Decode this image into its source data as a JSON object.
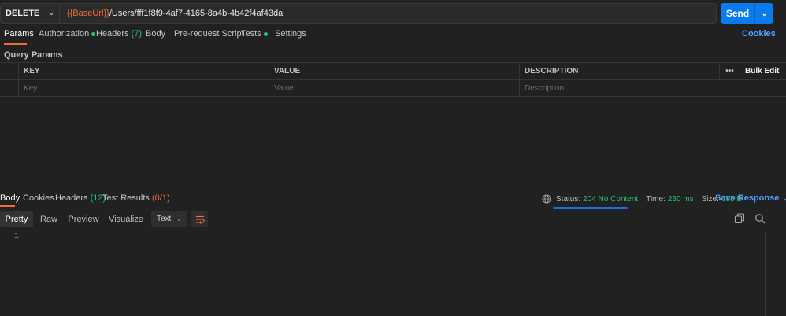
{
  "request": {
    "method": "DELETE",
    "url_variable": "{{BaseUrl}}",
    "url_path": "/Users/fff1f8f9-4af7-4165-8a4b-4b42f4af43da",
    "send_label": "Send"
  },
  "request_tabs": {
    "params": "Params",
    "authorization": "Authorization",
    "headers": "Headers",
    "headers_count": "(7)",
    "body": "Body",
    "prerequest": "Pre-request Script",
    "tests": "Tests",
    "settings": "Settings",
    "cookies": "Cookies"
  },
  "query_params": {
    "label": "Query Params",
    "columns": {
      "key": "KEY",
      "value": "VALUE",
      "description": "DESCRIPTION"
    },
    "bulk_edit": "Bulk Edit",
    "more": "•••",
    "placeholders": {
      "key": "Key",
      "value": "Value",
      "description": "Description"
    }
  },
  "response_tabs": {
    "body": "Body",
    "cookies": "Cookies",
    "headers": "Headers",
    "headers_count": "(12)",
    "test_results": "Test Results",
    "test_results_count": "(0/1)"
  },
  "response_status": {
    "status_label": "Status:",
    "status_value": "204 No Content",
    "time_label": "Time:",
    "time_value": "230 ms",
    "size_label": "Size:",
    "size_value": "688 B",
    "save_response": "Save Response"
  },
  "view": {
    "pretty": "Pretty",
    "raw": "Raw",
    "preview": "Preview",
    "visualize": "Visualize",
    "format": "Text",
    "line_number": "1"
  },
  "colors": {
    "accent": "#f26b3a",
    "send": "#097bed",
    "success": "#27c46a",
    "link": "#4ea6ff"
  }
}
